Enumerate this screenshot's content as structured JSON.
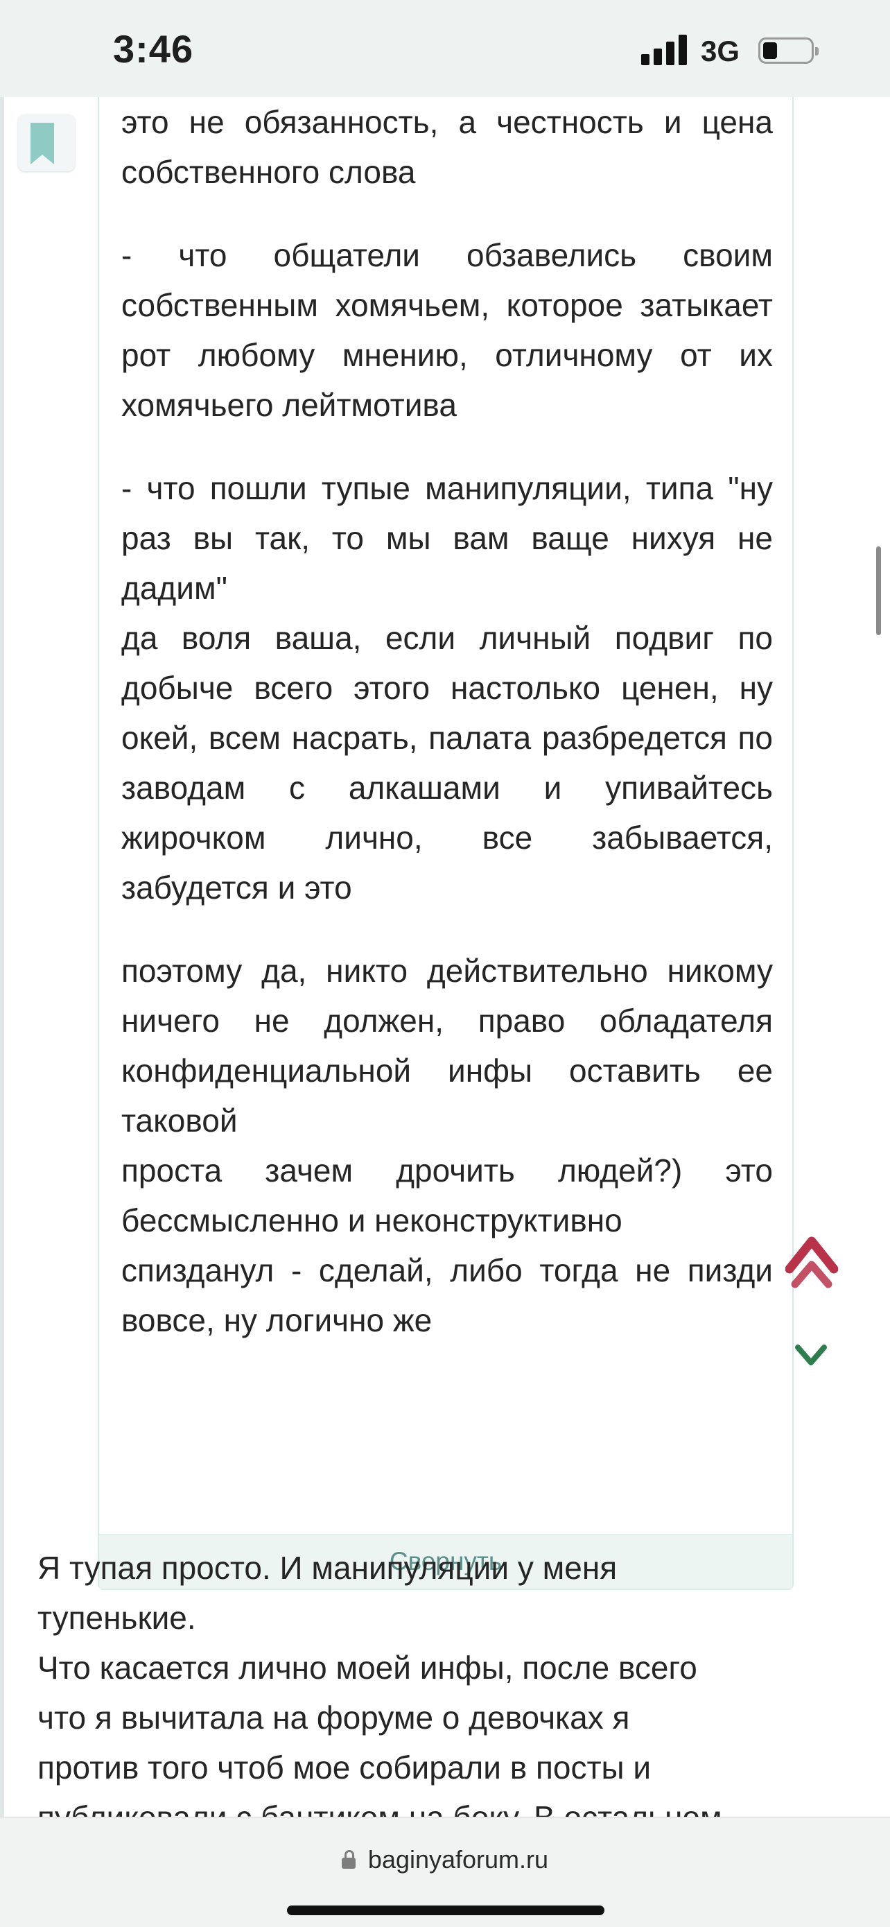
{
  "status_bar": {
    "time": "3:46",
    "network": "3G",
    "signal_bars": 4,
    "battery_level": 0.25
  },
  "icons": {
    "bookmark": "bookmark-icon",
    "scroll_up": "double-chevron-up-icon",
    "scroll_down": "chevron-down-icon",
    "lock": "lock-icon"
  },
  "colors": {
    "accent_teal": "#8fcbc4",
    "collapse_text": "#5c8f8a",
    "up_arrow": "#b8334a",
    "down_arrow": "#2f7d4f"
  },
  "quote": {
    "paragraphs": [
      "это не обязанность, а честность и цена собственного слова",
      "- что общатели обзавелись своим собственным хомячьем, которое затыкает рот любому мнению, отличному от их хомячьего лейтмотива",
      "- что пошли тупые манипуляции, типа \"ну раз вы так, то мы вам ваще нихуя не дадим\"",
      "да воля ваша, если личный подвиг по добыче всего этого настолько ценен, ну окей, всем насрать, палата разбредется по заводам с алкашами и упивайтесь жирочком лично, все забывается, забудется и это",
      "поэтому да, никто действительно никому ничего не должен, право обладателя конфиденциальной инфы оставить ее таковой",
      "проста зачем дрочить людей?) это бессмысленно и неконструктивно",
      "спизданул - сделай, либо тогда не пизди вовсе, ну логично же"
    ],
    "collapse_label": "Свернуть"
  },
  "reply": {
    "lines": [
      "Я тупая просто. И манипуляции у меня",
      "тупенькие.",
      "Что касается лично моей инфы, после всего",
      "что я вычитала на форуме о девочках я",
      "против того чтоб мое собирали в посты и",
      "публиковали с бантиком на боку. В остальном"
    ]
  },
  "browser": {
    "url": "baginyaforum.ru"
  }
}
